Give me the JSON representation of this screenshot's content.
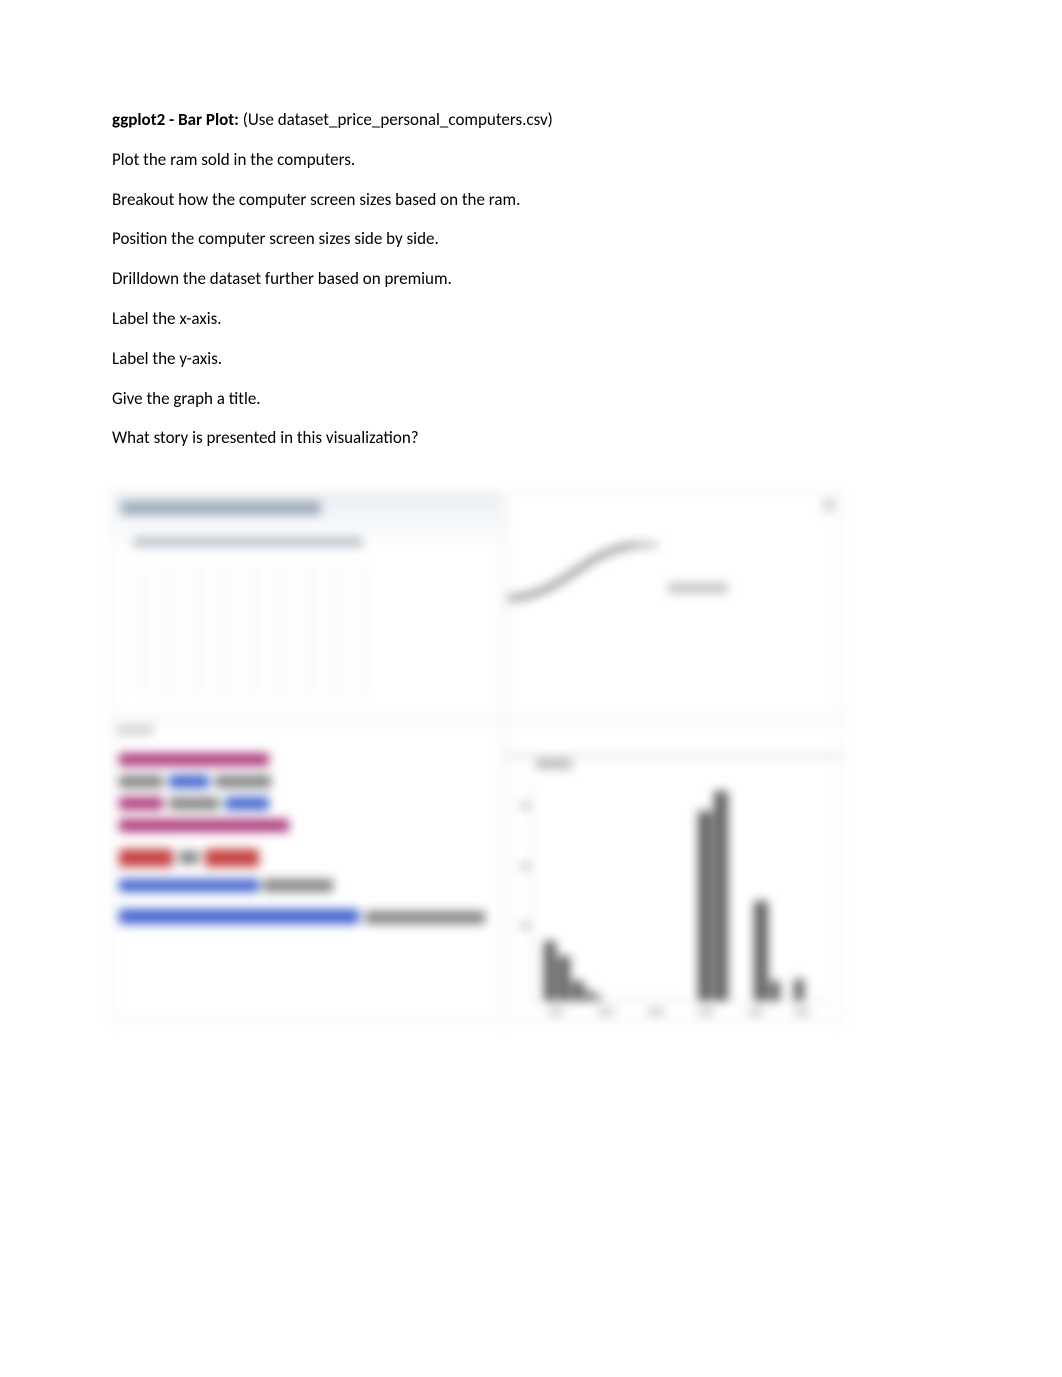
{
  "doc": {
    "heading_bold": "ggplot2 - Bar Plot:",
    "heading_rest": " (Use dataset_price_personal_computers.csv)",
    "lines": [
      "Plot the ram sold in the computers.",
      "Breakout how the computer screen sizes based on the ram.",
      "Position the computer screen sizes side by side.",
      "Drilldown the dataset further based on premium.",
      "Label the x-axis.",
      "Label the y-axis.",
      "Give the graph a title.",
      "What story is presented in this visualization?"
    ]
  },
  "chart_data": {
    "type": "bar",
    "note": "blurred embedded screenshot — values estimated from pixel heights",
    "x_positions": [
      1,
      2,
      3,
      4,
      5,
      6,
      7,
      8,
      9,
      10,
      11
    ],
    "values": [
      60,
      45,
      20,
      10,
      5,
      0,
      0,
      190,
      210,
      100,
      20
    ],
    "ylim": [
      0,
      220
    ],
    "title": "",
    "xlabel": "",
    "ylabel": ""
  }
}
